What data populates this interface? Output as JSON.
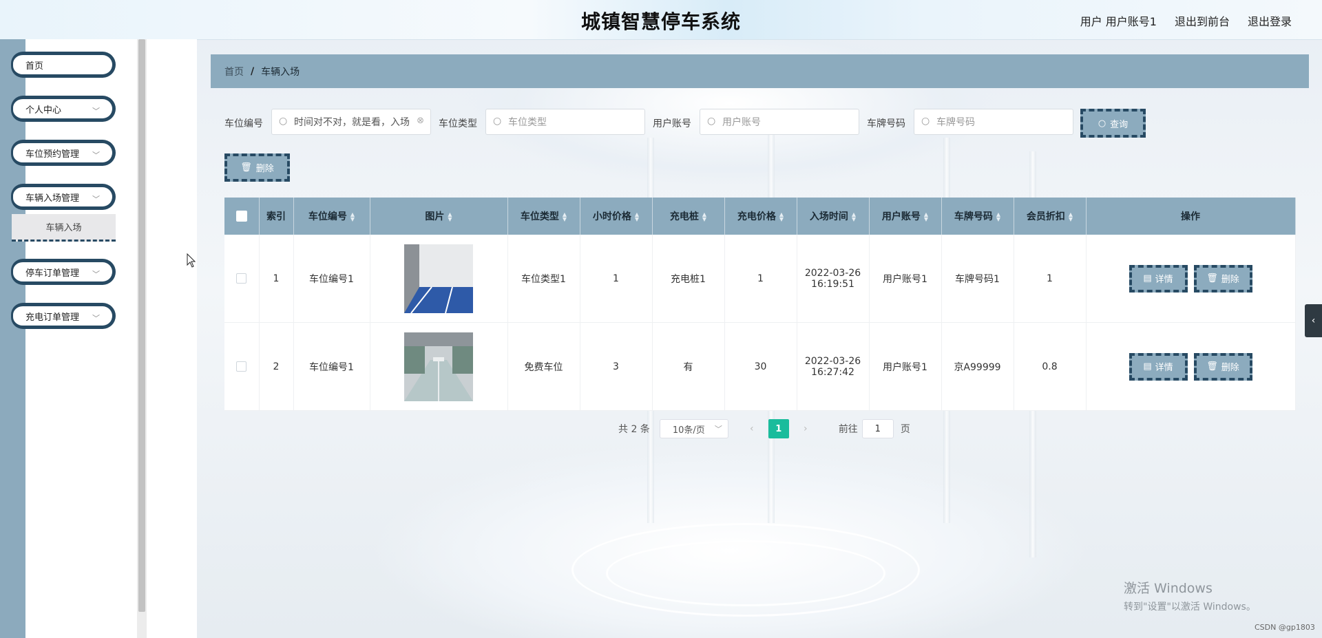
{
  "header": {
    "title": "城镇智慧停车系统",
    "user_label": "用户 用户账号1",
    "to_front": "退出到前台",
    "logout": "退出登录"
  },
  "sidebar": {
    "items": [
      {
        "label": "首页",
        "has_chevron": false
      },
      {
        "label": "个人中心",
        "has_chevron": true
      },
      {
        "label": "车位预约管理",
        "has_chevron": true
      },
      {
        "label": "车辆入场管理",
        "has_chevron": true
      },
      {
        "label": "停车订单管理",
        "has_chevron": true
      },
      {
        "label": "充电订单管理",
        "has_chevron": true
      }
    ],
    "active_sub": "车辆入场"
  },
  "breadcrumb": {
    "home": "首页",
    "separator": "/",
    "current": "车辆入场"
  },
  "search": {
    "parking_no_label": "车位编号",
    "parking_no_value": "时间对不对，就是看，入场",
    "parking_type_label": "车位类型",
    "parking_type_placeholder": "车位类型",
    "user_account_label": "用户账号",
    "user_account_placeholder": "用户账号",
    "plate_label": "车牌号码",
    "plate_placeholder": "车牌号码",
    "query_button": "查询"
  },
  "toolbar": {
    "delete_button": "删除"
  },
  "table": {
    "columns": [
      "索引",
      "车位编号",
      "图片",
      "车位类型",
      "小时价格",
      "充电桩",
      "充电价格",
      "入场时间",
      "用户账号",
      "车牌号码",
      "会员折扣",
      "操作"
    ],
    "rows": [
      {
        "index": "1",
        "parking_no": "车位编号1",
        "parking_type": "车位类型1",
        "hour_price": "1",
        "charger": "充电桩1",
        "charge_price": "1",
        "entry_date": "2022-03-26",
        "entry_time": "16:19:51",
        "user_account": "用户账号1",
        "plate": "车牌号码1",
        "discount": "1"
      },
      {
        "index": "2",
        "parking_no": "车位编号1",
        "parking_type": "免费车位",
        "hour_price": "3",
        "charger": "有",
        "charge_price": "30",
        "entry_date": "2022-03-26",
        "entry_time": "16:27:42",
        "user_account": "用户账号1",
        "plate": "京A99999",
        "discount": "0.8"
      }
    ],
    "detail_button": "详情",
    "delete_button": "删除"
  },
  "pagination": {
    "total": "共 2 条",
    "page_size": "10条/页",
    "current_page": "1",
    "goto_label": "前往",
    "goto_value": "1",
    "goto_unit": "页"
  },
  "watermark": {
    "line1": "激活 Windows",
    "line2": "转到\"设置\"以激活 Windows。"
  },
  "csdn": "CSDN @gp1803",
  "colors": {
    "accent": "#8cabbe",
    "dark_border": "#274a63",
    "page_active": "#1abc9c"
  }
}
